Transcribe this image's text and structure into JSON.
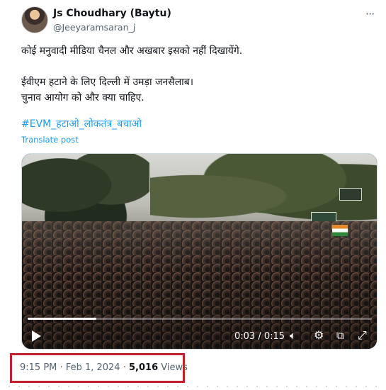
{
  "author": {
    "name": "Js Choudhary (Baytu)",
    "handle": "@Jeeyaramsaran_j",
    "affiliation_icon": "apple-icon"
  },
  "more_icon": "more-horizontal-icon",
  "tweet": {
    "line1": "कोई मनुवादी मीडिया चैनल और अखबार इसको नहीं दिखायेंगे.",
    "line2": "ईवीएम हटाने के लिए दिल्ली में उमड़ा जनसैलाब।",
    "line3": "चुनाव आयोग को और क्या चाहिए.",
    "hashtag": "#EVM_हटाओ_लोकतंत्र_बचाओ",
    "translate_label": "Translate post"
  },
  "video": {
    "current_time": "0:03",
    "duration": "0:15",
    "time_display": "0:03 / 0:15",
    "progress_fraction": 0.2,
    "icons": {
      "play": "play-icon",
      "volume": "volume-icon",
      "settings": "settings-icon",
      "pip": "picture-in-picture-icon",
      "fullscreen": "fullscreen-icon"
    }
  },
  "meta": {
    "time": "9:15 PM",
    "separator": "·",
    "date": "Feb 1, 2024",
    "views_count": "5,016",
    "views_label": "Views"
  },
  "colors": {
    "link": "#1d9bf0",
    "muted": "#536471",
    "highlight_box": "#c0202a"
  }
}
